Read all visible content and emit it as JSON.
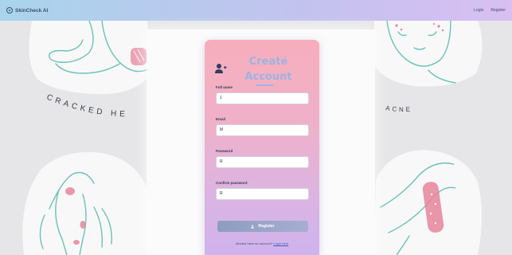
{
  "navbar": {
    "brand": "SkinCheck AI",
    "links": [
      "Login",
      "Register"
    ]
  },
  "background": {
    "left_caption": "CRACKED HE",
    "right_caption": "ACNE"
  },
  "form": {
    "title_line1": "Create",
    "title_line2": "Account",
    "fields": [
      {
        "label": "Full name",
        "value": "1"
      },
      {
        "label": "Email",
        "value": "M"
      },
      {
        "label": "Password",
        "value": "R"
      },
      {
        "label": "Confirm password",
        "value": "R"
      }
    ],
    "register_button": "Register",
    "login_prompt": "Already have an account?",
    "login_link": "Login here"
  },
  "colors": {
    "navbar_start": "#a9d4ec",
    "navbar_end": "#d9bff2",
    "card_top": "#f7aebc",
    "card_bottom": "#cfb3ee",
    "title": "#9cb3e2",
    "button": "#8c9dc0",
    "line_art": "#6cc2b4",
    "skin_spot": "#e7869c"
  },
  "icons": {
    "brand": "target-icon",
    "form_header": "user-plus-icon",
    "register_button": "user-add-icon"
  }
}
